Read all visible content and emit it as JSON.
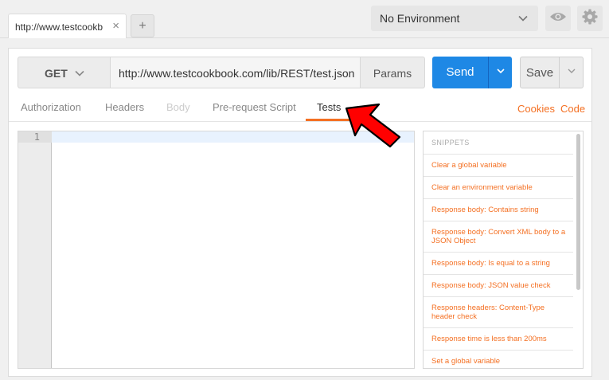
{
  "tabs": {
    "active_title": "http://www.testcookb",
    "close_symbol": "×",
    "new_tab_symbol": "+"
  },
  "environment": {
    "selected": "No Environment"
  },
  "request": {
    "method": "GET",
    "url": "http://www.testcookbook.com/lib/REST/test.json",
    "params_label": "Params",
    "send_label": "Send",
    "save_label": "Save"
  },
  "request_tabs": [
    "Authorization",
    "Headers",
    "Body",
    "Pre-request Script",
    "Tests"
  ],
  "active_request_tab": "Tests",
  "links": {
    "cookies": "Cookies",
    "code": "Code"
  },
  "editor": {
    "line_numbers": [
      "1"
    ]
  },
  "snippets": {
    "heading": "SNIPPETS",
    "items": [
      "Clear a global variable",
      "Clear an environment variable",
      "Response body: Contains string",
      "Response body: Convert XML body to a JSON Object",
      "Response body: Is equal to a string",
      "Response body: JSON value check",
      "Response headers: Content-Type header check",
      "Response time is less than 200ms",
      "Set a global variable"
    ]
  },
  "colors": {
    "accent": "#f47023",
    "send": "#1e88e5",
    "arrow": "#ff0000"
  },
  "icons": [
    "close-icon",
    "plus-icon",
    "chevron-down-icon",
    "eye-icon",
    "gear-icon",
    "pointer-arrow-icon"
  ]
}
